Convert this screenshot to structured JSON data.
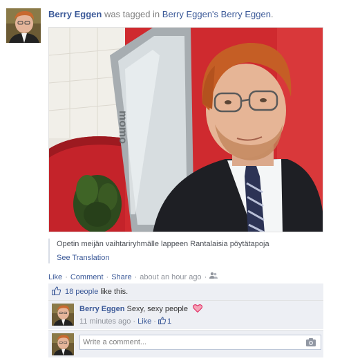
{
  "story": {
    "actor_name": "Berry Eggen",
    "headline_mid": "was tagged in",
    "album_owner": "Berry Eggen's",
    "album_name": "Berry Eggen",
    "period": "."
  },
  "caption": {
    "text": "Opetin meijän vaihtariryhmälle lappeen Rantalaisia pöytätapoja",
    "see_translation": "See Translation"
  },
  "actions": {
    "like": "Like",
    "comment": "Comment",
    "share": "Share",
    "timestamp": "about an hour ago",
    "privacy_icon": "friends-icon"
  },
  "likes": {
    "count_link": "18 people",
    "suffix": "like this."
  },
  "comment": {
    "author": "Berry Eggen",
    "text": "Sexy, sexy people",
    "timestamp": "11 minutes ago",
    "like": "Like",
    "like_count": "1",
    "emoji": "heart-icon"
  },
  "composer": {
    "placeholder": "Write a comment...",
    "camera_icon": "camera-icon"
  },
  "colors": {
    "link": "#3b5998",
    "ufi_background": "#edeff4",
    "heart": "#e0245e"
  }
}
